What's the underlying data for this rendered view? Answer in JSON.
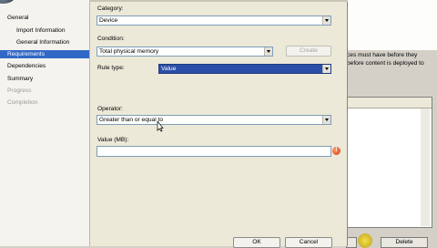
{
  "wizard_nav": {
    "items": [
      {
        "label": "General",
        "level": 0,
        "state": "normal"
      },
      {
        "label": "Import Information",
        "level": 1,
        "state": "normal"
      },
      {
        "label": "General Information",
        "level": 1,
        "state": "normal"
      },
      {
        "label": "Requirements",
        "level": 0,
        "state": "selected"
      },
      {
        "label": "Dependencies",
        "level": 0,
        "state": "normal"
      },
      {
        "label": "Summary",
        "level": 0,
        "state": "normal"
      },
      {
        "label": "Progress",
        "level": 0,
        "state": "disabled"
      },
      {
        "label": "Completion",
        "level": 0,
        "state": "disabled"
      }
    ]
  },
  "dialog": {
    "category_label": "Category:",
    "category_value": "Device",
    "condition_label": "Condition:",
    "condition_value": "Total physical memory",
    "create_label": "Create",
    "rule_type_label": "Rule type:",
    "rule_type_value": "Value",
    "operator_label": "Operator:",
    "operator_value": "Greater than or equal to",
    "value_label": "Value (MB):",
    "value_input": "",
    "ok_label": "OK",
    "cancel_label": "Cancel",
    "error_glyph": "!"
  },
  "background_window": {
    "text_line1": "ces must have before they",
    "text_line2": "before content is deployed to",
    "delete_label": "Delete"
  },
  "colors": {
    "selection": "#3168c6",
    "dialog_bg": "#ece9d8",
    "error": "#d83a10"
  }
}
